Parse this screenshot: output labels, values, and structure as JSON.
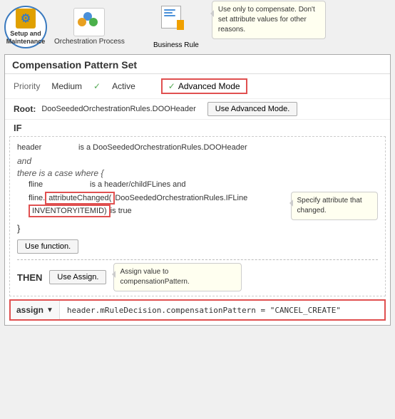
{
  "nav": {
    "setup_label": "Setup and\nMaintenance",
    "orchestration_label": "Orchestration\nProcess",
    "business_rule_label": "Business\nRule",
    "tooltip_biz": "Use only to compensate. Don't set attribute values for other reasons."
  },
  "panel": {
    "title": "Compensation Pattern Set",
    "priority_label": "Priority",
    "priority_value": "Medium",
    "active_check": "✓",
    "active_label": "Active",
    "advanced_check": "✓",
    "advanced_label": "Advanced Mode",
    "root_label": "Root:",
    "root_value": "DooSeededOrchestrationRules.DOOHeader",
    "adv_mode_btn": "Use Advanced Mode.",
    "if_label": "IF",
    "then_label": "THEN"
  },
  "rule": {
    "header_text": "header",
    "is_a": "is a DooSeededOrchestrationRules.DOOHeader",
    "and_text": "and",
    "there_case": "there is a case where  {",
    "fline_text": "fline",
    "is_childlines": "is a header/childFLines  and",
    "fline_attr_pre": "fline.",
    "attr_changed": "attributeChanged(",
    "doo_class": "DooSeededOrchestrationRules.IFLine",
    "inventory_item": "INVENTORYITEMID)",
    "is_true": " is true",
    "close_brace": "}",
    "use_function_btn": "Use function.",
    "use_assign_btn": "Use Assign.",
    "assign_tooltip": "Assign value  to compensationPattern.",
    "specify_tooltip": "Specify attribute that changed."
  },
  "bottom": {
    "assign_label": "assign",
    "assign_arrow": "▼",
    "assign_value": "header.mRuleDecision.compensationPattern  =  \"CANCEL_CREATE\""
  }
}
